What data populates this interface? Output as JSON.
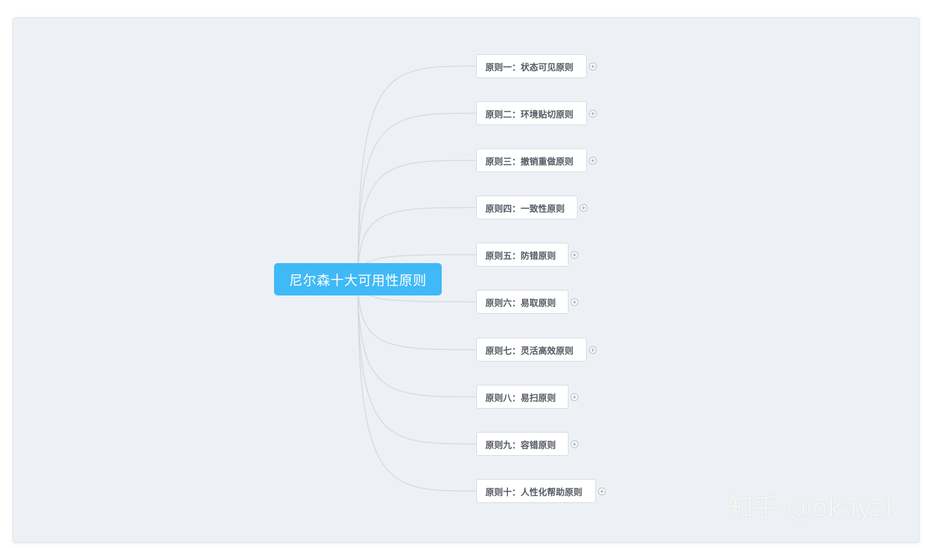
{
  "root": {
    "label": "尼尔森十大可用性原则"
  },
  "branches": [
    {
      "label": "原则一：状态可见原则"
    },
    {
      "label": "原则二：环境贴切原则"
    },
    {
      "label": "原则三：撤销重做原则"
    },
    {
      "label": "原则四：一致性原则"
    },
    {
      "label": "原则五：防错原则"
    },
    {
      "label": "原则六：易取原则"
    },
    {
      "label": "原则七：灵活高效原则"
    },
    {
      "label": "原则八：易扫原则"
    },
    {
      "label": "原则九：容错原则"
    },
    {
      "label": "原则十：人性化帮助原则"
    }
  ],
  "expander_symbol": "+",
  "watermark": "知乎 @okayzl",
  "colors": {
    "root": "#40b9f7",
    "canvas": "#edf1f5",
    "link": "#d3d9df"
  }
}
